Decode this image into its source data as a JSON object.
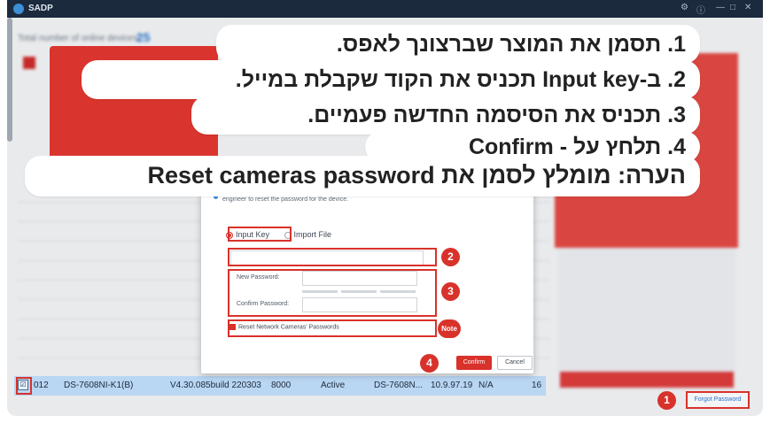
{
  "window": {
    "title": "SADP",
    "controls": [
      "⚙",
      "ⓘ",
      "—",
      "□",
      "✕"
    ]
  },
  "background": {
    "total_label": "Total number of online devices:",
    "total_count": "25"
  },
  "selected_row": {
    "index": "012",
    "device_type": "DS-7608NI-K1(B)",
    "firmware": "V4.30.085build 220303",
    "port": "8000",
    "status": "Active",
    "serial": "DS-7608N...",
    "ip": "10.9.97.19",
    "extra": "N/A",
    "last": "16"
  },
  "dialog": {
    "note": "engineer to reset the password for the device.",
    "input_key_label": "Input Key",
    "import_file_label": "Import File",
    "key_value": "",
    "new_password_label": "New Password:",
    "confirm_password_label": "Confirm Password:",
    "reset_network_label": "Reset Network Cameras' Passwords",
    "confirm_label": "Confirm",
    "cancel_label": "Cancel"
  },
  "forgot_password_label": "Forgot Password",
  "badges": {
    "b1": "1",
    "b2": "2",
    "b3": "3",
    "b4": "4",
    "note": "Note"
  },
  "instructions": {
    "line1": "1. תסמן את המוצר שברצונך לאפס.",
    "line2": "2. ב-Input key תכניס את הקוד שקבלת במייל.",
    "line3": "3. תכניס את הסיסמה החדשה פעמיים.",
    "line4": "4. תלחץ על - Confirm",
    "line5": "הערה: מומלץ לסמן את Reset cameras password"
  },
  "colors": {
    "accent_red": "#d8322b",
    "titlebar": "#1b2a3d",
    "link_blue": "#2b73c6",
    "selected_row": "#b9d6f3"
  }
}
